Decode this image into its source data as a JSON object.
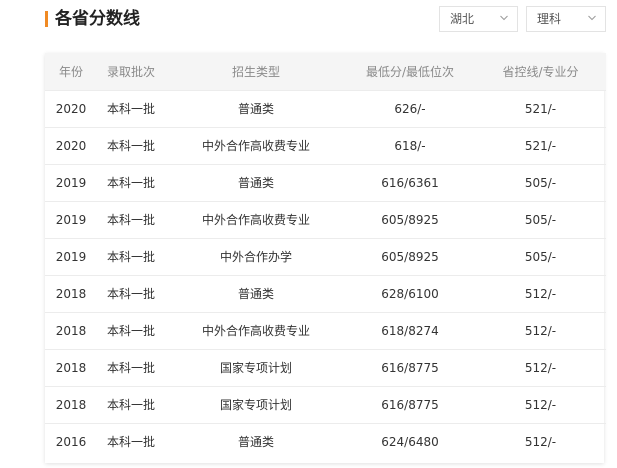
{
  "header": {
    "title": "各省分数线",
    "province_select": {
      "value": "湖北"
    },
    "subject_select": {
      "value": "理科"
    }
  },
  "table": {
    "columns": [
      "年份",
      "录取批次",
      "招生类型",
      "最低分/最低位次",
      "省控线/专业分"
    ],
    "rows": [
      [
        "2020",
        "本科一批",
        "普通类",
        "626/-",
        "521/-"
      ],
      [
        "2020",
        "本科一批",
        "中外合作高收费专业",
        "618/-",
        "521/-"
      ],
      [
        "2019",
        "本科一批",
        "普通类",
        "616/6361",
        "505/-"
      ],
      [
        "2019",
        "本科一批",
        "中外合作高收费专业",
        "605/8925",
        "505/-"
      ],
      [
        "2019",
        "本科一批",
        "中外合作办学",
        "605/8925",
        "505/-"
      ],
      [
        "2018",
        "本科一批",
        "普通类",
        "628/6100",
        "512/-"
      ],
      [
        "2018",
        "本科一批",
        "中外合作高收费专业",
        "618/8274",
        "512/-"
      ],
      [
        "2018",
        "本科一批",
        "国家专项计划",
        "616/8775",
        "512/-"
      ],
      [
        "2018",
        "本科一批",
        "国家专项计划",
        "616/8775",
        "512/-"
      ],
      [
        "2016",
        "本科一批",
        "普通类",
        "624/6480",
        "512/-"
      ]
    ]
  },
  "colors": {
    "accent": "#f08a24",
    "header_bg": "#f5f5f5"
  }
}
